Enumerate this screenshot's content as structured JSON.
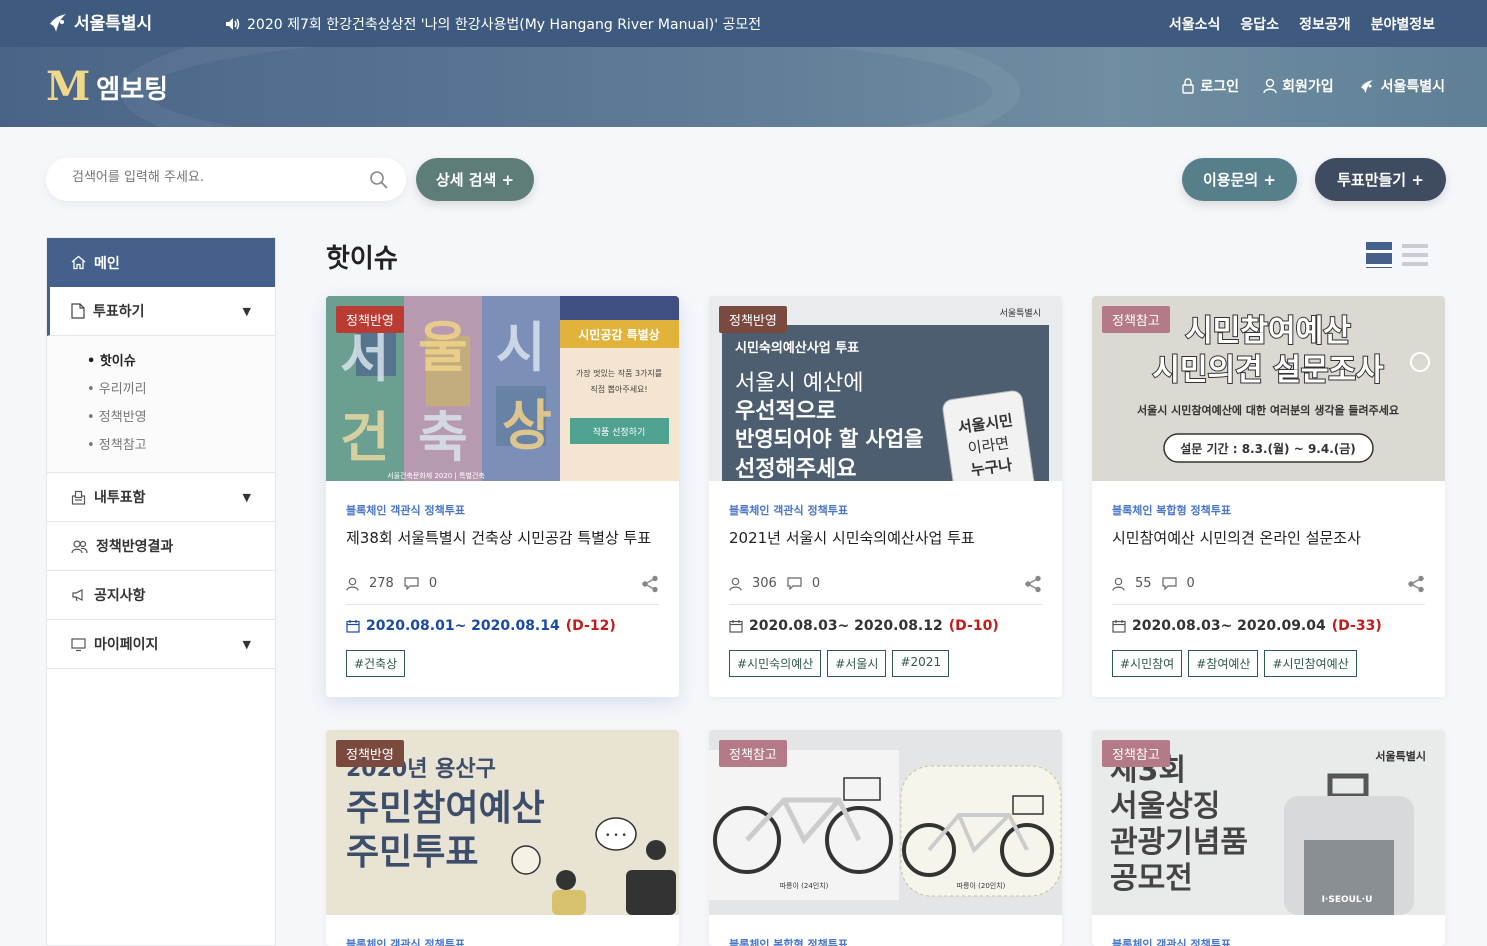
{
  "topbar": {
    "logo_text": "서울특별시",
    "notice": "2020 제7회 한강건축상상전 '나의 한강사용법(My Hangang River Manual)' 공모전",
    "links": [
      "서울소식",
      "응답소",
      "정보공개",
      "분야별정보"
    ]
  },
  "banner": {
    "brand_mark": "M",
    "brand_name": "엠보팅",
    "auth": {
      "login": "로그인",
      "signup": "회원가입",
      "seoul": "서울특별시"
    }
  },
  "search": {
    "placeholder": "검색어를 입력해 주세요."
  },
  "buttons": {
    "advanced": "상세 검색 +",
    "inquiry": "이용문의 +",
    "make_vote": "투표만들기 +"
  },
  "sidebar": {
    "main": "메인",
    "vote": "투표하기",
    "sub": [
      "• 핫이슈",
      "• 우리끼리",
      "• 정책반영",
      "• 정책참고"
    ],
    "my_votes": "내투표함",
    "policy_results": "정책반영결과",
    "notice": "공지사항",
    "mypage": "마이페이지"
  },
  "section_title": "핫이슈",
  "cards": [
    {
      "badge": "정책반영",
      "category": "블록체인 객관식 정책투표",
      "title": "제38회 서울특별시 건축상 시민공감 특별상 투표",
      "participants": "278",
      "comments": "0",
      "range": "2020.08.01~ 2020.08.14",
      "dday": "(D-12)",
      "tags": [
        "#건축상"
      ],
      "thumb": {
        "chars": [
          "서",
          "울",
          "시",
          "건",
          "축",
          "상"
        ],
        "panel_title": "시민공감 특별상",
        "panel_text1": "가장 멋있는 작품 3가지를",
        "panel_text2": "직접 뽑아주세요!",
        "panel_button": "작품 선정하기",
        "footer": "서울건축문화제 2020 | 특별건축"
      }
    },
    {
      "badge": "정책반영",
      "category": "블록체인 객관식 정책투표",
      "title": "2021년 서울시 시민숙의예산사업 투표",
      "participants": "306",
      "comments": "0",
      "range": "2020.08.03~ 2020.08.12",
      "dday": "(D-10)",
      "tags": [
        "#시민숙의예산",
        "#서울시",
        "#2021"
      ],
      "thumb": {
        "logo": "서울특별시",
        "line0": "시민숙의예산사업 투표",
        "line1": "서울시 예산에",
        "line2": "우선적으로",
        "line3": "반영되어야 할 사업을",
        "line4": "선정해주세요",
        "phone1": "서울시민",
        "phone2": "이라면",
        "phone3": "누구나"
      }
    },
    {
      "badge": "정책참고",
      "category": "블록체인 복합형 정책투표",
      "title": "시민참여예산 시민의견 온라인 설문조사",
      "participants": "55",
      "comments": "0",
      "range": "2020.08.03~ 2020.09.04",
      "dday": "(D-33)",
      "tags": [
        "#시민참여",
        "#참여예산",
        "#시민참여예산"
      ],
      "thumb": {
        "line1": "시민참여예산",
        "line2": "시민의견 설문조사",
        "line3": "서울시 시민참여예산에 대한 여러분의 생각을 들려주세요",
        "period": "설문 기간 : 8.3.(월) ~ 9.4.(금)"
      }
    },
    {
      "badge": "정책반영",
      "category": "블록체인 객관식 정책투표",
      "thumb": {
        "line1": "2020년 용산구",
        "line2": "주민참여예산",
        "line3": "주민투표",
        "bubble": "• • •"
      }
    },
    {
      "badge": "정책참고",
      "category": "블록체인 복합형 정책투표",
      "thumb": {
        "cap1": "따릉이 (24인치)",
        "cap2": "따릉이 (20인치)"
      }
    },
    {
      "badge": "정책참고",
      "category": "블록체인 객관식 정책투표",
      "thumb": {
        "logo": "서울특별시",
        "line1": "제3회",
        "line2": "서울상징",
        "line3": "관광기념품",
        "line4": "공모전",
        "tag": "I·SEOUL·U"
      }
    }
  ],
  "colors": {
    "topbar": "#3e5a7f",
    "sidebar_active": "#45608a",
    "badge_red": "#b93b31",
    "badge_brown": "#7a4a3e",
    "badge_pink": "#b57a88",
    "category_blue": "#4a76c9",
    "dday_red": "#c41a1a",
    "tag_green": "#2f5a4c"
  },
  "icons": [
    "seoul-logo-icon",
    "speaker-icon",
    "lock-icon",
    "user-icon",
    "search-icon",
    "home-icon",
    "document-icon",
    "ballot-box-icon",
    "people-icon",
    "megaphone-icon",
    "monitor-icon",
    "comment-icon",
    "share-icon",
    "calendar-icon"
  ]
}
